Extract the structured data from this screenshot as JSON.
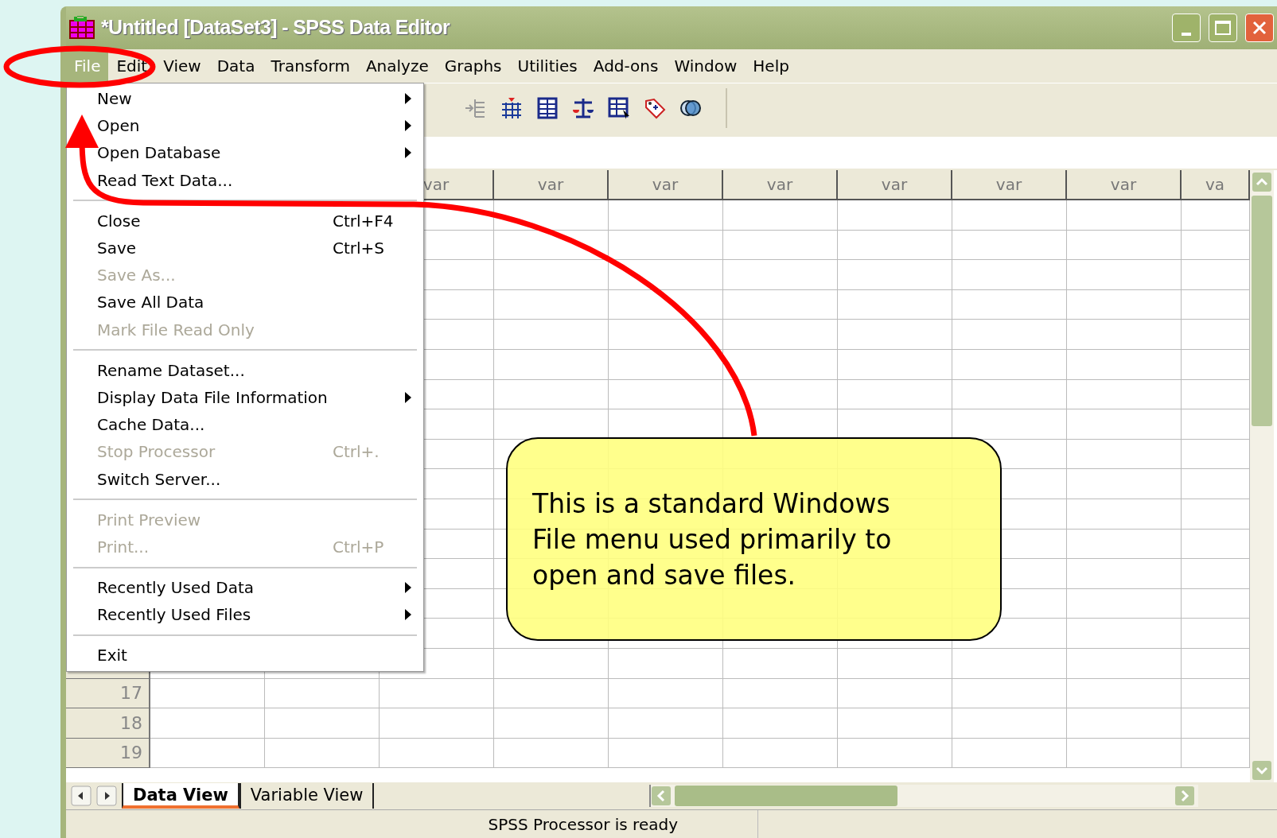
{
  "window": {
    "title": "*Untitled [DataSet3] - SPSS Data Editor"
  },
  "menu_bar": [
    {
      "label": "File",
      "selected": true
    },
    {
      "label": "Edit",
      "selected": false
    },
    {
      "label": "View",
      "selected": false
    },
    {
      "label": "Data",
      "selected": false
    },
    {
      "label": "Transform",
      "selected": false
    },
    {
      "label": "Analyze",
      "selected": false
    },
    {
      "label": "Graphs",
      "selected": false
    },
    {
      "label": "Utilities",
      "selected": false
    },
    {
      "label": "Add-ons",
      "selected": false
    },
    {
      "label": "Window",
      "selected": false
    },
    {
      "label": "Help",
      "selected": false
    }
  ],
  "file_menu": [
    {
      "kind": "item",
      "label": "New",
      "submenu": true,
      "disabled": false
    },
    {
      "kind": "item",
      "label": "Open",
      "submenu": true,
      "disabled": false
    },
    {
      "kind": "item",
      "label": "Open Database",
      "submenu": true,
      "disabled": false
    },
    {
      "kind": "item",
      "label": "Read Text Data...",
      "submenu": false,
      "disabled": false
    },
    {
      "kind": "separator"
    },
    {
      "kind": "item",
      "label": "Close",
      "shortcut": "Ctrl+F4",
      "submenu": false,
      "disabled": false
    },
    {
      "kind": "item",
      "label": "Save",
      "shortcut": "Ctrl+S",
      "submenu": false,
      "disabled": false
    },
    {
      "kind": "item",
      "label": "Save As...",
      "submenu": false,
      "disabled": true
    },
    {
      "kind": "item",
      "label": "Save All Data",
      "submenu": false,
      "disabled": false
    },
    {
      "kind": "item",
      "label": "Mark File Read Only",
      "submenu": false,
      "disabled": true
    },
    {
      "kind": "separator"
    },
    {
      "kind": "item",
      "label": "Rename Dataset...",
      "submenu": false,
      "disabled": false
    },
    {
      "kind": "item",
      "label": "Display Data File Information",
      "submenu": true,
      "disabled": false
    },
    {
      "kind": "item",
      "label": "Cache Data...",
      "submenu": false,
      "disabled": false
    },
    {
      "kind": "item",
      "label": "Stop Processor",
      "shortcut": "Ctrl+.",
      "submenu": false,
      "disabled": true
    },
    {
      "kind": "item",
      "label": "Switch Server...",
      "submenu": false,
      "disabled": false
    },
    {
      "kind": "separator"
    },
    {
      "kind": "item",
      "label": "Print Preview",
      "submenu": false,
      "disabled": true
    },
    {
      "kind": "item",
      "label": "Print...",
      "shortcut": "Ctrl+P",
      "submenu": false,
      "disabled": true
    },
    {
      "kind": "separator"
    },
    {
      "kind": "item",
      "label": "Recently Used Data",
      "submenu": true,
      "disabled": false
    },
    {
      "kind": "item",
      "label": "Recently Used Files",
      "submenu": true,
      "disabled": false
    },
    {
      "kind": "separator"
    },
    {
      "kind": "item",
      "label": "Exit",
      "submenu": false,
      "disabled": false
    }
  ],
  "grid": {
    "column_headers": [
      "var",
      "var",
      "var",
      "var",
      "var",
      "var",
      "var",
      "va"
    ],
    "row_numbers": [
      "17",
      "18",
      "19"
    ]
  },
  "sheet_tabs": [
    {
      "label": "Data View",
      "selected": true
    },
    {
      "label": "Variable View",
      "selected": false
    }
  ],
  "status_bar": {
    "text": "SPSS Processor is ready"
  },
  "callout": {
    "text": "This is a standard Windows File menu used primarily to open and save files."
  }
}
